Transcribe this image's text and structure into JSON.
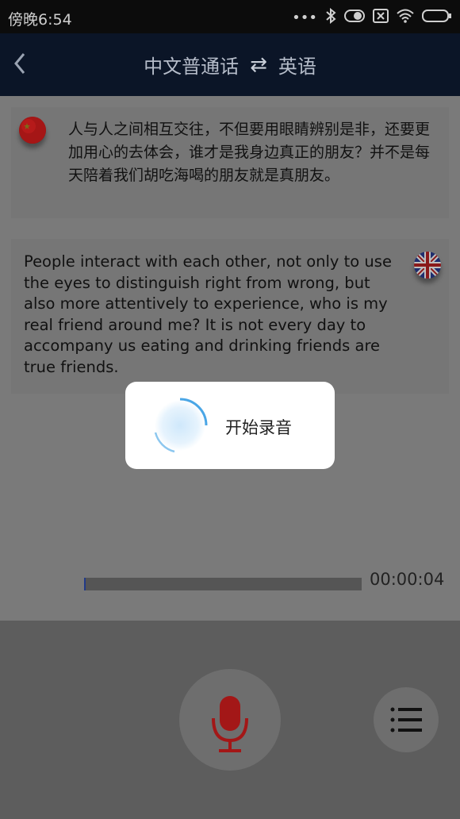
{
  "status_bar": {
    "time": "傍晚6:54"
  },
  "header": {
    "source_language": "中文普通话",
    "target_language": "英语",
    "swap_symbol": "⇄"
  },
  "messages": [
    {
      "language": "zh",
      "flag": "china-flag-icon",
      "text": "人与人之间相互交往，不但要用眼睛辨别是非，还要更加用心的去体会，谁才是我身边真正的朋友？并不是每天陪着我们胡吃海喝的朋友就是真朋友。"
    },
    {
      "language": "en",
      "flag": "uk-flag-icon",
      "text": "People interact with each other, not only to use the eyes to distinguish right from wrong, but also more attentively to experience, who is my real friend around me? It is not every day to accompany us eating and drinking friends are true friends."
    }
  ],
  "playback": {
    "elapsed": "00:00:04"
  },
  "dialog": {
    "label": "开始录音"
  },
  "colors": {
    "header_bg": "#0b1527",
    "mic_red": "#b5191a",
    "spinner_blue": "#4aa6e6"
  }
}
